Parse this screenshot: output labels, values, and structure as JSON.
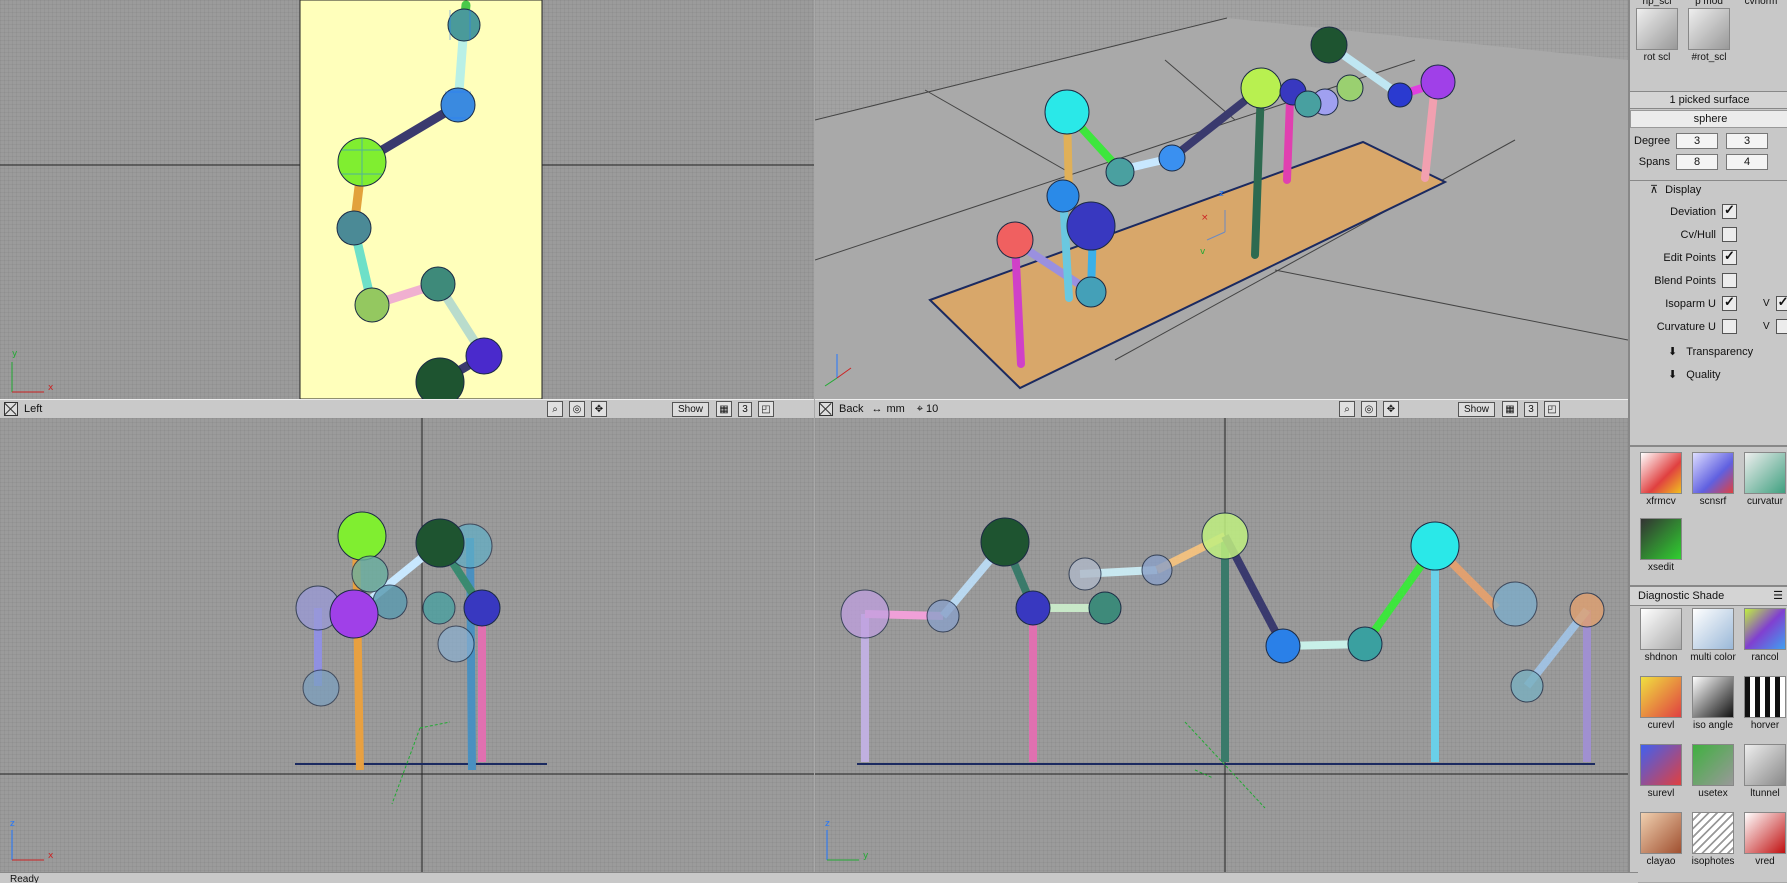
{
  "viewports": {
    "left": {
      "label": "Left",
      "show_label": "Show",
      "layer_count": "3"
    },
    "back": {
      "label": "Back",
      "units": "mm",
      "grid_value": "10",
      "show_label": "Show",
      "layer_count": "3"
    }
  },
  "axes": {
    "x": "x",
    "y": "y",
    "z": "z"
  },
  "panel": {
    "top_tools": [
      {
        "top": "rlp_scl",
        "label": "rot scl"
      },
      {
        "top": "p mod",
        "label": "#rot_scl"
      },
      {
        "top": "cvnorm",
        "label": ""
      }
    ],
    "picked": "1 picked surface",
    "object_name": "sphere",
    "degree": {
      "label": "Degree",
      "u": "3",
      "v": "3"
    },
    "spans": {
      "label": "Spans",
      "u": "8",
      "v": "4"
    },
    "display_header": "Display",
    "display_items": [
      {
        "label": "Deviation",
        "checked": true
      },
      {
        "label": "Cv/Hull",
        "checked": false
      },
      {
        "label": "Edit Points",
        "checked": true
      },
      {
        "label": "Blend Points",
        "checked": false
      },
      {
        "label": "Isoparm U",
        "checked": true,
        "v_label": "V",
        "v_checked": true
      },
      {
        "label": "Curvature U",
        "checked": false,
        "v_label": "V",
        "v_checked": false
      }
    ],
    "transparency": "Transparency",
    "quality": "Quality",
    "surface_tools": [
      {
        "name": "xfrmcv"
      },
      {
        "name": "scnsrf"
      },
      {
        "name": "curvatur"
      },
      {
        "name": "xsedit"
      }
    ],
    "diagnostic_header": "Diagnostic Shade",
    "shade_tools": [
      {
        "name": "shdnon"
      },
      {
        "name": "multi color"
      },
      {
        "name": "rancol"
      },
      {
        "name": "curevl"
      },
      {
        "name": "iso angle"
      },
      {
        "name": "horver"
      },
      {
        "name": "surevl"
      },
      {
        "name": "usetex"
      },
      {
        "name": "ltunnel"
      },
      {
        "name": "clayao"
      },
      {
        "name": "isophotes"
      },
      {
        "name": "vred"
      }
    ]
  },
  "status_text": "Ready"
}
